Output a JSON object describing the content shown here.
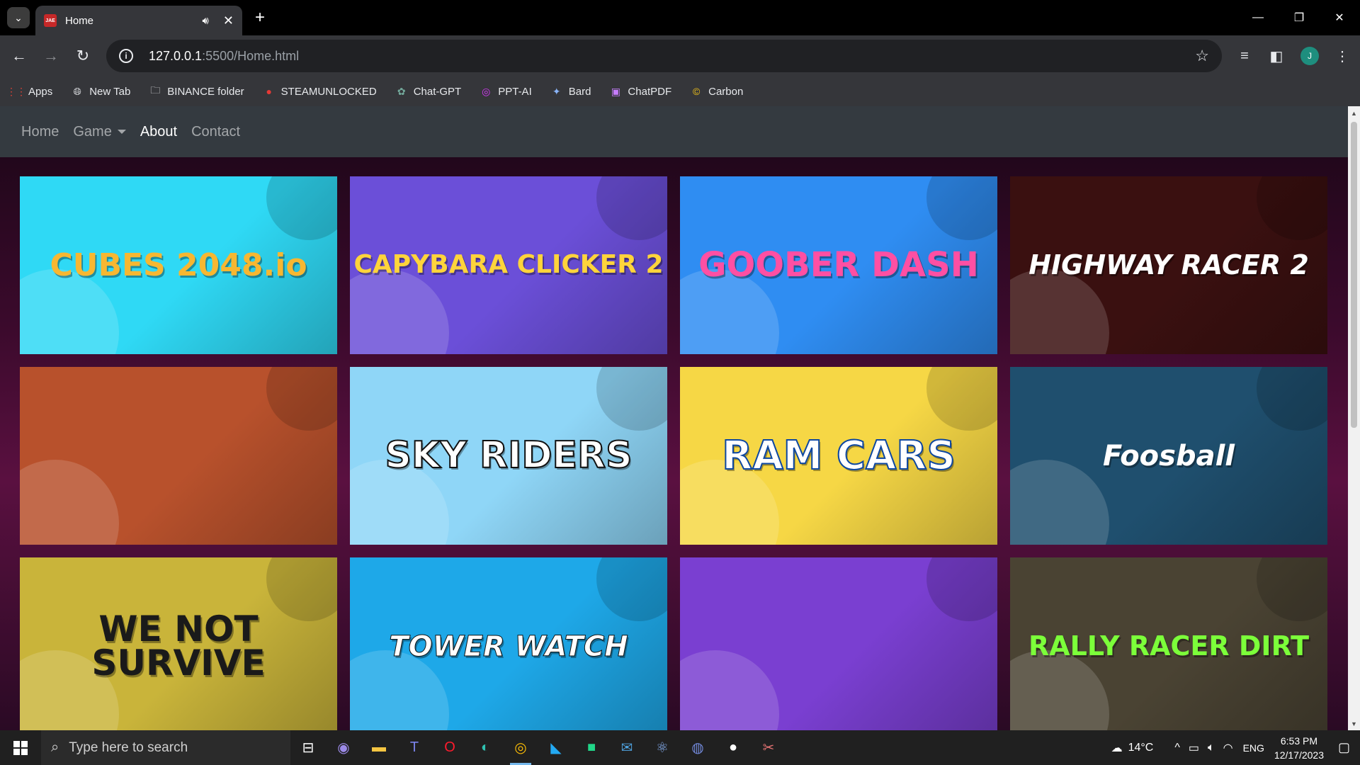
{
  "browser": {
    "tab_title": "Home",
    "tab_favicon_text": "JAE",
    "url_host": "127.0.0.1",
    "url_path": ":5500/Home.html",
    "profile_initial": "J"
  },
  "bookmarks": [
    {
      "label": "Apps",
      "icon": "apps-grid-icon"
    },
    {
      "label": "New Tab",
      "icon": "globe-icon"
    },
    {
      "label": "BINANCE folder",
      "icon": "folder-icon"
    },
    {
      "label": "STEAMUNLOCKED",
      "icon": "steam-icon"
    },
    {
      "label": "Chat-GPT",
      "icon": "openai-icon"
    },
    {
      "label": "PPT-AI",
      "icon": "ppt-ai-icon"
    },
    {
      "label": "Bard",
      "icon": "bard-icon"
    },
    {
      "label": "ChatPDF",
      "icon": "chatpdf-icon"
    },
    {
      "label": "Carbon",
      "icon": "carbon-icon"
    }
  ],
  "site_nav": {
    "home": "Home",
    "game": "Game",
    "about": "About",
    "contact": "Contact",
    "active": "About"
  },
  "games": [
    {
      "title": "CUBES 2048.io",
      "bg": "#2fd9f5",
      "fg": "#f7b731"
    },
    {
      "title": "CAPYBARA CLICKER 2",
      "bg": "#6b4fd8",
      "fg": "#ffd43b"
    },
    {
      "title": "GOOBER DASH",
      "bg": "#2f8df2",
      "fg": "#ff4fa3"
    },
    {
      "title": "HIGHWAY RACER 2",
      "bg": "#3a1010",
      "fg": "#ffffff"
    },
    {
      "title": "",
      "bg": "#b8512c",
      "fg": "#ffffff"
    },
    {
      "title": "SKY RIDERS",
      "bg": "#8fd6f7",
      "fg": "#ffffff"
    },
    {
      "title": "RAM CARS",
      "bg": "#f6d745",
      "fg": "#ffffff"
    },
    {
      "title": "Foosball",
      "bg": "#1f4f6e",
      "fg": "#ffffff"
    },
    {
      "title": "WE NOT SURVIVE",
      "bg": "#c9b43a",
      "fg": "#1a1a1a"
    },
    {
      "title": "TOWER WATCH",
      "bg": "#1ea8e8",
      "fg": "#ffffff"
    },
    {
      "title": "",
      "bg": "#7a3fd1",
      "fg": "#ffffff"
    },
    {
      "title": "RALLY RACER DIRT",
      "bg": "#4a4333",
      "fg": "#7cff3a"
    }
  ],
  "taskbar": {
    "search_placeholder": "Type here to search",
    "weather": "14°C",
    "language": "ENG",
    "time": "6:53 PM",
    "date": "12/17/2023"
  }
}
